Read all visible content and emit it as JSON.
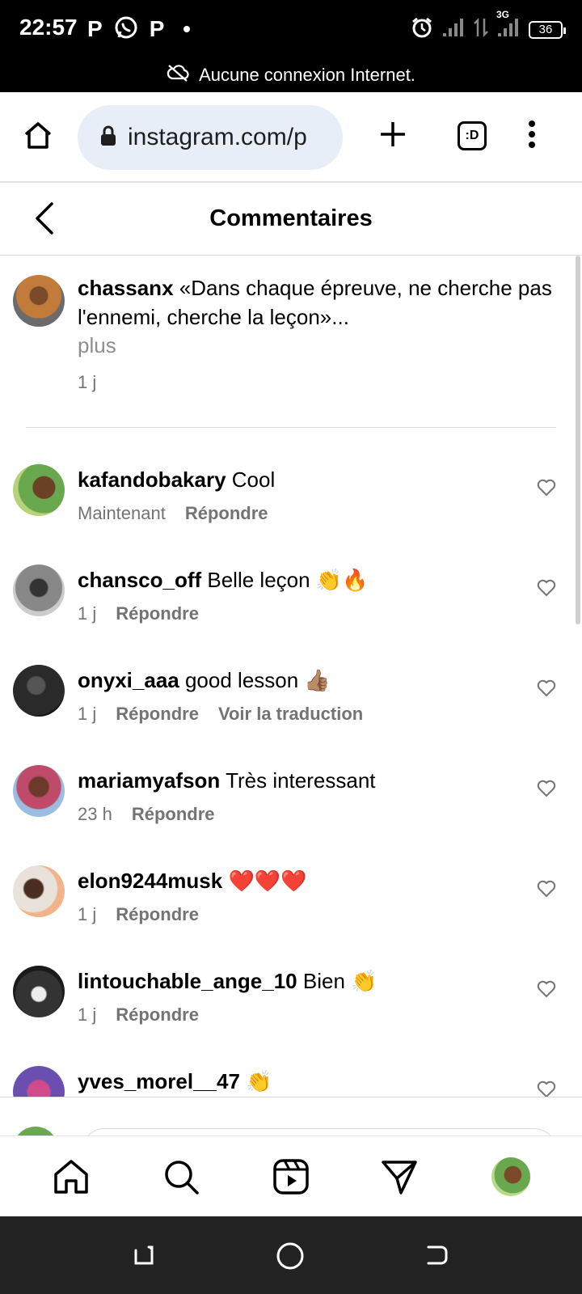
{
  "status_bar": {
    "time": "22:57",
    "notif_icons": [
      "P",
      "P"
    ],
    "network": "3G",
    "battery": "36"
  },
  "offline_banner": "Aucune connexion Internet.",
  "browser": {
    "url": "instagram.com/p"
  },
  "header": {
    "title": "Commentaires"
  },
  "caption": {
    "username": "chassanx",
    "text": " «Dans chaque épreuve, ne cherche pas l'ennemi, cherche la leçon»...",
    "more_label": "plus",
    "time": "1 j"
  },
  "comments": [
    {
      "username": "kafandobakary",
      "text": " Cool",
      "time": "Maintenant",
      "reply": "Répondre",
      "extra": ""
    },
    {
      "username": "chansco_off",
      "text": " Belle leçon 👏🔥",
      "time": "1 j",
      "reply": "Répondre",
      "extra": ""
    },
    {
      "username": "onyxi_aaa",
      "text": " good lesson 👍🏽",
      "time": "1 j",
      "reply": "Répondre",
      "extra": "Voir la traduction"
    },
    {
      "username": "mariamyafson",
      "text": " Très interessant",
      "time": "23 h",
      "reply": "Répondre",
      "extra": ""
    },
    {
      "username": "elon9244musk",
      "text": " ❤️❤️❤️",
      "time": "1 j",
      "reply": "Répondre",
      "extra": ""
    },
    {
      "username": "lintouchable_ange_10",
      "text": " Bien 👏",
      "time": "1 j",
      "reply": "Répondre",
      "extra": ""
    },
    {
      "username": "yves_morel__47",
      "text": " 👏",
      "time": "",
      "reply": "",
      "extra": ""
    }
  ],
  "colors": {
    "meta_gray": "#737373",
    "url_bg": "#e8eef8",
    "divider": "#dbdbdb"
  }
}
